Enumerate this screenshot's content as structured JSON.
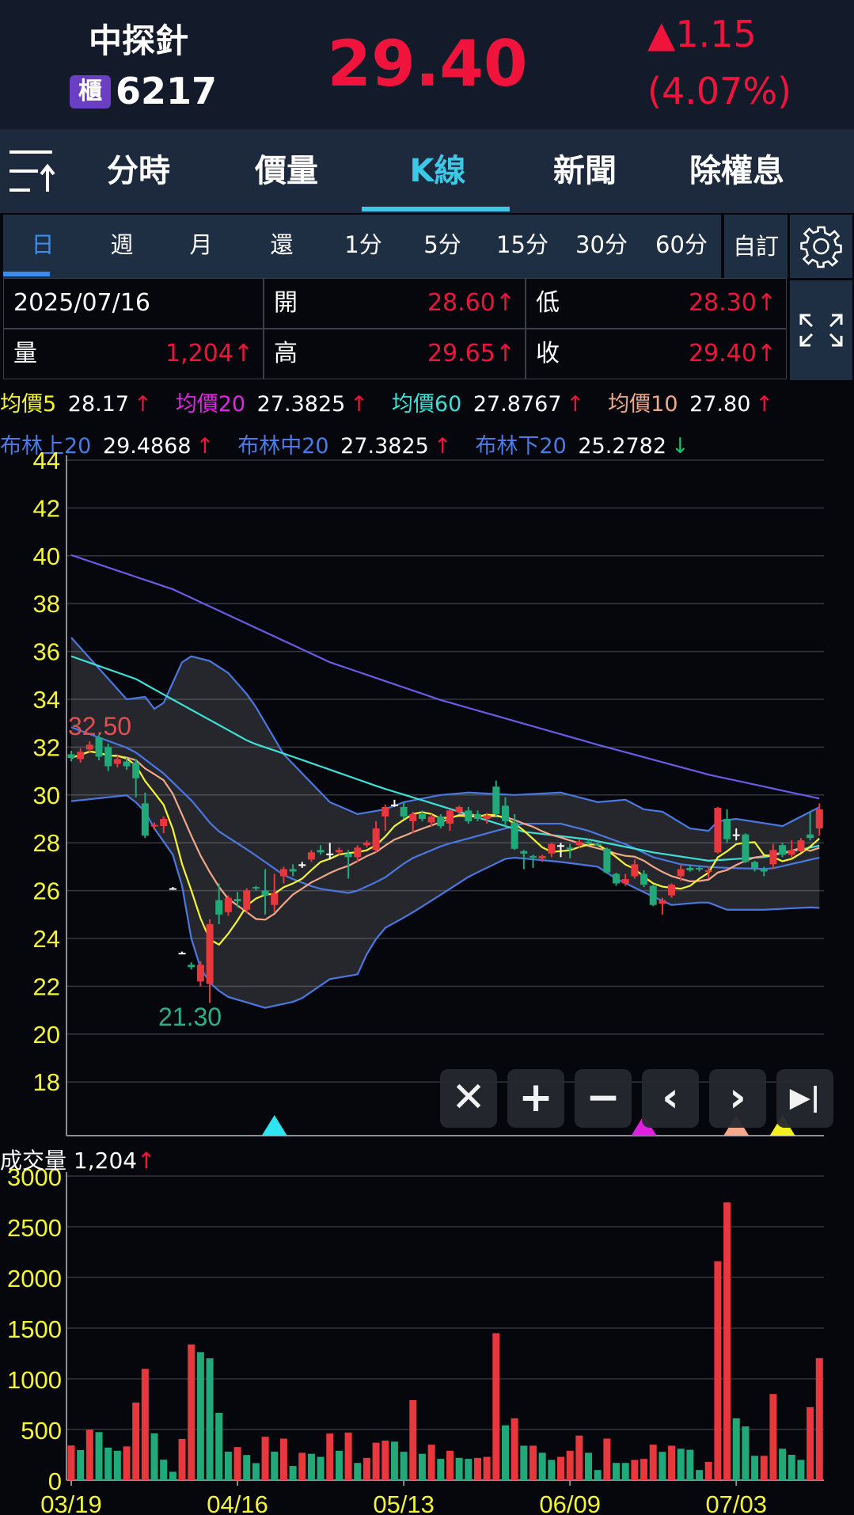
{
  "header": {
    "name": "中探針",
    "market_badge": "櫃",
    "code": "6217",
    "price": "29.40",
    "change": "1.15",
    "change_pct": "(4.07%)",
    "up_arrow": "▲"
  },
  "tabs": [
    {
      "label": "分時"
    },
    {
      "label": "價量"
    },
    {
      "label": "K線",
      "active": true
    },
    {
      "label": "新聞"
    },
    {
      "label": "除權息"
    }
  ],
  "periods": [
    {
      "label": "日",
      "active": true
    },
    {
      "label": "週"
    },
    {
      "label": "月"
    },
    {
      "label": "還"
    },
    {
      "label": "1分"
    },
    {
      "label": "5分"
    },
    {
      "label": "15分"
    },
    {
      "label": "30分"
    },
    {
      "label": "60分"
    }
  ],
  "custom_label": "自訂",
  "info": {
    "date": "2025/07/16",
    "open_label": "開",
    "open": "28.60↑",
    "low_label": "低",
    "low": "28.30↑",
    "vol_label": "量",
    "vol": "1,204↑",
    "high_label": "高",
    "high": "29.65↑",
    "close_label": "收",
    "close": "29.40↑"
  },
  "legend1": [
    {
      "label": "均價5",
      "value": "28.17",
      "arrow": "↑",
      "color": "#f5f532"
    },
    {
      "label": "均價20",
      "value": "27.3825",
      "arrow": "↑",
      "color": "#e026e0"
    },
    {
      "label": "均價60",
      "value": "27.8767",
      "arrow": "↑",
      "color": "#3ee0d8"
    },
    {
      "label": "均價10",
      "value": "27.80",
      "arrow": "↑",
      "color": "#f0a888"
    }
  ],
  "legend2": [
    {
      "label": "布林上20",
      "value": "29.4868",
      "arrow": "↑",
      "color": "#4a7be6"
    },
    {
      "label": "布林中20",
      "value": "27.3825",
      "arrow": "↑",
      "color": "#4a7be6"
    },
    {
      "label": "布林下20",
      "value": "25.2782",
      "arrow": "↓",
      "color": "#4a7be6"
    }
  ],
  "volume_label": "成交量",
  "volume_value": "1,204",
  "volume_arrow": "↑",
  "colors": {
    "up": "#e8383d",
    "down": "#22a97a",
    "axis_label": "#f5f532"
  },
  "chart_data": {
    "type": "candlestick",
    "price_ticks": [
      44,
      42,
      40,
      38,
      36,
      34,
      32,
      30,
      28,
      26,
      24,
      22,
      20,
      18
    ],
    "price_range": [
      16.3,
      44
    ],
    "high_label": "32.50",
    "low_label": "21.30",
    "date_ticks": [
      {
        "i": 0,
        "label": "03/19"
      },
      {
        "i": 18,
        "label": "04/16"
      },
      {
        "i": 36,
        "label": "05/13"
      },
      {
        "i": 54,
        "label": "06/09"
      },
      {
        "i": 72,
        "label": "07/03"
      }
    ],
    "candles": [
      [
        31.7,
        31.85,
        31.4,
        31.55
      ],
      [
        31.5,
        31.95,
        31.35,
        31.8
      ],
      [
        31.9,
        32.25,
        31.75,
        32.1
      ],
      [
        32.4,
        32.5,
        31.45,
        31.6
      ],
      [
        32.0,
        32.15,
        31.0,
        31.2
      ],
      [
        31.3,
        31.65,
        31.15,
        31.5
      ],
      [
        31.4,
        31.55,
        31.05,
        31.2
      ],
      [
        31.35,
        31.5,
        29.9,
        30.7
      ],
      [
        29.65,
        30.1,
        28.2,
        28.3
      ],
      [
        28.7,
        28.85,
        28.55,
        28.75
      ],
      [
        28.7,
        29.1,
        28.4,
        29.0
      ],
      [
        26.1,
        26.15,
        26.05,
        26.1
      ],
      [
        23.4,
        23.45,
        23.35,
        23.4
      ],
      [
        22.9,
        23.0,
        22.7,
        22.8
      ],
      [
        22.2,
        23.05,
        22.0,
        22.9
      ],
      [
        22.1,
        24.8,
        21.3,
        24.6
      ],
      [
        25.6,
        26.3,
        24.6,
        25.0
      ],
      [
        25.1,
        25.8,
        24.95,
        25.7
      ],
      [
        25.65,
        25.95,
        25.3,
        25.55
      ],
      [
        25.2,
        26.1,
        25.05,
        26.0
      ],
      [
        26.15,
        26.2,
        26.0,
        26.1
      ],
      [
        26.0,
        26.9,
        25.0,
        25.8
      ],
      [
        25.4,
        26.7,
        25.1,
        25.9
      ],
      [
        26.6,
        27.0,
        26.3,
        26.9
      ],
      [
        26.9,
        27.1,
        26.6,
        26.8
      ],
      [
        27.1,
        27.2,
        26.95,
        27.1
      ],
      [
        27.3,
        27.7,
        27.2,
        27.6
      ],
      [
        27.7,
        27.9,
        27.5,
        27.6
      ],
      [
        27.55,
        28.0,
        27.3,
        27.55
      ],
      [
        27.6,
        27.8,
        27.5,
        27.7
      ],
      [
        27.55,
        27.7,
        26.5,
        27.4
      ],
      [
        27.4,
        27.9,
        27.2,
        27.8
      ],
      [
        27.9,
        28.1,
        27.8,
        28.0
      ],
      [
        27.7,
        28.9,
        27.6,
        28.6
      ],
      [
        29.1,
        29.6,
        28.5,
        29.5
      ],
      [
        29.6,
        29.8,
        29.5,
        29.6
      ],
      [
        29.5,
        29.7,
        29.0,
        29.1
      ],
      [
        28.9,
        29.3,
        28.4,
        29.2
      ],
      [
        29.2,
        29.35,
        28.9,
        29.0
      ],
      [
        28.85,
        29.2,
        28.7,
        29.1
      ],
      [
        29.1,
        29.2,
        28.6,
        28.7
      ],
      [
        28.8,
        29.4,
        28.5,
        29.35
      ],
      [
        29.3,
        29.55,
        29.2,
        29.5
      ],
      [
        29.35,
        29.5,
        28.8,
        28.9
      ],
      [
        29.2,
        29.35,
        28.9,
        29.0
      ],
      [
        29.0,
        29.25,
        28.8,
        29.15
      ],
      [
        30.35,
        30.6,
        29.1,
        29.2
      ],
      [
        29.55,
        29.9,
        28.7,
        28.9
      ],
      [
        28.85,
        29.2,
        27.7,
        27.75
      ],
      [
        27.65,
        27.7,
        26.9,
        27.55
      ],
      [
        27.45,
        27.5,
        26.95,
        27.4
      ],
      [
        27.35,
        27.5,
        27.2,
        27.45
      ],
      [
        27.55,
        28.0,
        27.4,
        27.95
      ],
      [
        27.9,
        28.0,
        27.4,
        27.9
      ],
      [
        27.8,
        27.95,
        27.35,
        27.75
      ],
      [
        27.9,
        28.15,
        27.8,
        28.05
      ],
      [
        28.05,
        28.15,
        27.9,
        28.0
      ],
      [
        27.95,
        28.05,
        27.85,
        27.9
      ],
      [
        27.75,
        27.8,
        26.7,
        26.76
      ],
      [
        26.7,
        26.75,
        26.2,
        26.3
      ],
      [
        26.3,
        26.7,
        26.2,
        26.48
      ],
      [
        26.6,
        27.3,
        26.5,
        27.1
      ],
      [
        26.7,
        26.85,
        26.15,
        26.25
      ],
      [
        26.2,
        26.25,
        25.35,
        25.4
      ],
      [
        25.45,
        25.7,
        25.0,
        25.6
      ],
      [
        25.8,
        26.3,
        25.7,
        26.25
      ],
      [
        26.6,
        27.1,
        26.4,
        26.9
      ],
      [
        26.95,
        27.1,
        26.8,
        26.85
      ],
      [
        26.95,
        27.05,
        26.8,
        26.9
      ],
      [
        26.8,
        27.0,
        26.5,
        26.85
      ],
      [
        27.6,
        29.5,
        27.55,
        29.46
      ],
      [
        29.0,
        29.4,
        28.0,
        28.15
      ],
      [
        28.35,
        28.6,
        28.1,
        28.35
      ],
      [
        28.35,
        28.4,
        27.15,
        27.2
      ],
      [
        27.2,
        27.25,
        26.8,
        26.95
      ],
      [
        26.9,
        27.0,
        26.6,
        26.8
      ],
      [
        27.1,
        27.95,
        26.9,
        27.7
      ],
      [
        27.9,
        28.0,
        27.4,
        27.5
      ],
      [
        27.5,
        28.1,
        27.4,
        27.7
      ],
      [
        27.65,
        28.2,
        27.6,
        28.1
      ],
      [
        28.35,
        29.3,
        28.1,
        28.2
      ],
      [
        28.6,
        29.65,
        28.3,
        29.4
      ]
    ],
    "boll_upper": [
      [
        0,
        36.58
      ],
      [
        6,
        34.0
      ],
      [
        8,
        34.1
      ],
      [
        9,
        33.6
      ],
      [
        10,
        33.85
      ],
      [
        12,
        35.55
      ],
      [
        13,
        35.8
      ],
      [
        15,
        35.6
      ],
      [
        17,
        35.1
      ],
      [
        19.5,
        34.0
      ],
      [
        23,
        31.7
      ],
      [
        28,
        29.7
      ],
      [
        31,
        29.2
      ],
      [
        34,
        29.4
      ],
      [
        36,
        29.7
      ],
      [
        40,
        30.0
      ],
      [
        43,
        30.1
      ],
      [
        48,
        30.0
      ],
      [
        53,
        30.1
      ],
      [
        57,
        29.7
      ],
      [
        60,
        29.8
      ],
      [
        62,
        29.4
      ],
      [
        64,
        29.3
      ],
      [
        67,
        28.6
      ],
      [
        69,
        28.5
      ],
      [
        70,
        28.9
      ],
      [
        72,
        29.0
      ],
      [
        77,
        28.7
      ],
      [
        81,
        29.49
      ]
    ],
    "boll_mid": [
      [
        0,
        32.83
      ],
      [
        6.6,
        31.89
      ],
      [
        10,
        30.9
      ],
      [
        13.2,
        29.7
      ],
      [
        15.5,
        28.6
      ],
      [
        19.5,
        27.6
      ],
      [
        23.2,
        26.6
      ],
      [
        26.6,
        26.1
      ],
      [
        30,
        25.9
      ],
      [
        31,
        26.0
      ],
      [
        33.8,
        26.5
      ],
      [
        36.6,
        27.3
      ],
      [
        40.3,
        27.9
      ],
      [
        46,
        28.5
      ],
      [
        49,
        28.8
      ],
      [
        53,
        28.8
      ],
      [
        56,
        28.5
      ],
      [
        60.3,
        27.9
      ],
      [
        63,
        27.4
      ],
      [
        66,
        27.1
      ],
      [
        68.6,
        27.0
      ],
      [
        71,
        26.95
      ],
      [
        75.6,
        26.9
      ],
      [
        81,
        27.38
      ]
    ],
    "boll_lower": [
      [
        0,
        29.74
      ],
      [
        6.1,
        29.99
      ],
      [
        7.8,
        29.43
      ],
      [
        9,
        28.6
      ],
      [
        11,
        27.5
      ],
      [
        12,
        26.2
      ],
      [
        13,
        24.0
      ],
      [
        14.3,
        22.4
      ],
      [
        16.6,
        21.6
      ],
      [
        21,
        21.1
      ],
      [
        24.6,
        21.4
      ],
      [
        28,
        22.3
      ],
      [
        31,
        22.5
      ],
      [
        32.3,
        23.6
      ],
      [
        33.8,
        24.4
      ],
      [
        36.6,
        25.0
      ],
      [
        40.3,
        25.9
      ],
      [
        43.1,
        26.6
      ],
      [
        47.4,
        27.4
      ],
      [
        53,
        27.2
      ],
      [
        57,
        27.0
      ],
      [
        59,
        26.5
      ],
      [
        63,
        25.75
      ],
      [
        65,
        25.4
      ],
      [
        68,
        25.5
      ],
      [
        69.3,
        25.5
      ],
      [
        70.7,
        25.2
      ],
      [
        75,
        25.2
      ],
      [
        80,
        25.3
      ],
      [
        81,
        25.28
      ]
    ],
    "ma60": [
      [
        0,
        35.8
      ],
      [
        7,
        34.85
      ],
      [
        10,
        34.2
      ],
      [
        14.7,
        33.2
      ],
      [
        19.4,
        32.2
      ],
      [
        24,
        31.6
      ],
      [
        33.6,
        30.3
      ],
      [
        39.5,
        29.6
      ],
      [
        49,
        28.46
      ],
      [
        56,
        28.14
      ],
      [
        63,
        27.6
      ],
      [
        69,
        27.25
      ],
      [
        75,
        27.4
      ],
      [
        81,
        27.88
      ]
    ],
    "ma_long": [
      [
        0,
        40.03
      ],
      [
        11,
        38.6
      ],
      [
        28,
        35.55
      ],
      [
        40,
        33.97
      ],
      [
        57,
        32.1
      ],
      [
        69,
        30.85
      ],
      [
        81,
        29.85
      ]
    ],
    "volume_ticks": [
      3000,
      2500,
      2000,
      1500,
      1000,
      500,
      0
    ],
    "volumes": [
      342,
      297,
      498,
      474,
      321,
      290,
      333,
      765,
      1098,
      462,
      202,
      83,
      407,
      1339,
      1263,
      1202,
      664,
      281,
      327,
      248,
      168,
      428,
      281,
      410,
      140,
      270,
      260,
      230,
      460,
      290,
      470,
      170,
      220,
      370,
      390,
      380,
      280,
      790,
      260,
      350,
      210,
      290,
      220,
      210,
      220,
      230,
      1450,
      540,
      610,
      340,
      340,
      270,
      200,
      230,
      290,
      440,
      270,
      100,
      410,
      170,
      170,
      200,
      210,
      350,
      280,
      340,
      310,
      300,
      100,
      180,
      2160,
      2740,
      610,
      530,
      240,
      240,
      850,
      310,
      250,
      200,
      720,
      1204
    ],
    "volume_up": [
      1,
      0,
      1,
      0,
      0,
      0,
      1,
      1,
      1,
      0,
      0,
      0,
      1,
      1,
      0,
      0,
      0,
      0,
      1,
      0,
      0,
      1,
      0,
      1,
      0,
      1,
      0,
      0,
      1,
      0,
      1,
      0,
      1,
      1,
      1,
      0,
      0,
      1,
      0,
      1,
      0,
      1,
      0,
      0,
      1,
      1,
      1,
      0,
      1,
      0,
      1,
      0,
      0,
      1,
      1,
      1,
      0,
      0,
      1,
      0,
      0,
      1,
      1,
      1,
      0,
      1,
      0,
      0,
      0,
      1,
      1,
      1,
      0,
      0,
      0,
      1,
      1,
      0,
      0,
      0,
      1,
      1
    ],
    "signal_markers": [
      {
        "i": 22,
        "color": "#2ee6f0"
      },
      {
        "i": 62,
        "color": "#e020e0"
      },
      {
        "i": 72,
        "color": "#f5a88a"
      },
      {
        "i": 77,
        "color": "#f5f020"
      }
    ]
  },
  "controls": [
    {
      "name": "close",
      "glyph": "✕"
    },
    {
      "name": "zoom-in",
      "glyph": "+"
    },
    {
      "name": "zoom-out",
      "glyph": "−"
    },
    {
      "name": "scroll-left",
      "glyph": "‹"
    },
    {
      "name": "scroll-right",
      "glyph": "›"
    },
    {
      "name": "jump-latest",
      "glyph": "▶|"
    }
  ]
}
